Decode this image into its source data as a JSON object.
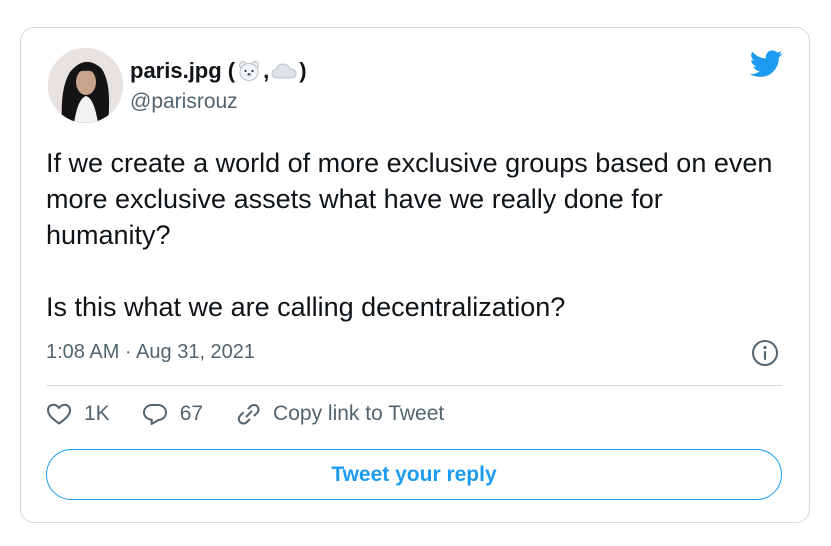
{
  "tweet": {
    "author": {
      "name_prefix": "paris.jpg (",
      "name_sep": ",",
      "name_suffix": ")",
      "handle": "@parisrouz"
    },
    "text": "If we create a world of more exclusive groups based on even more exclusive assets what have we really done for humanity?\n\nIs this what we are calling decentralization?",
    "timestamp": "1:08 AM · Aug 31, 2021"
  },
  "actions": {
    "likes": "1K",
    "replies": "67",
    "copy_link_label": "Copy link to Tweet"
  },
  "reply_button_label": "Tweet your reply",
  "colors": {
    "brand_blue": "#1d9bf0",
    "text_primary": "#0f1419",
    "text_secondary": "#536471",
    "border": "#cfd9de"
  },
  "icons": {
    "bird": "twitter-bird-icon",
    "info": "info-icon",
    "like": "heart-icon",
    "reply": "reply-bubble-icon",
    "copy_link": "link-icon",
    "name_emoji_1": "polar-bear-emoji",
    "name_emoji_2": "cloud-emoji"
  }
}
